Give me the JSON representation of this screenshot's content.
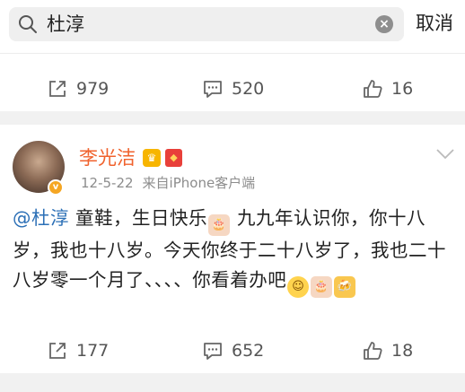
{
  "search": {
    "query": "杜淳",
    "cancel_label": "取消"
  },
  "top_actions": {
    "repost_count": "979",
    "comment_count": "520",
    "like_count": "16"
  },
  "post": {
    "author": "李光洁",
    "date": "12-5-22",
    "source": "来自iPhone客户端",
    "mention": "@杜淳",
    "text_part1": " 童鞋，生日快乐",
    "text_part2": " 九九年认识你，你十八岁，我也十八岁。今天你终于二十八岁了，我也二十八岁零一个月了、、、、你看着办吧",
    "actions": {
      "repost_count": "177",
      "comment_count": "652",
      "like_count": "18"
    }
  },
  "icons": {
    "search": "search-icon",
    "clear": "clear-icon",
    "repost": "repost-icon",
    "comment": "comment-icon",
    "like": "thumbs-up-icon",
    "chevron": "chevron-down-icon",
    "cake": "birthday-cake-emoji",
    "grin": "grinning-face-emoji",
    "beer": "beer-cheers-emoji"
  },
  "colors": {
    "author_name": "#f0622d",
    "mention": "#2b6fb6",
    "separator": "#f1f1f1",
    "meta_text": "#8c8c8c"
  }
}
